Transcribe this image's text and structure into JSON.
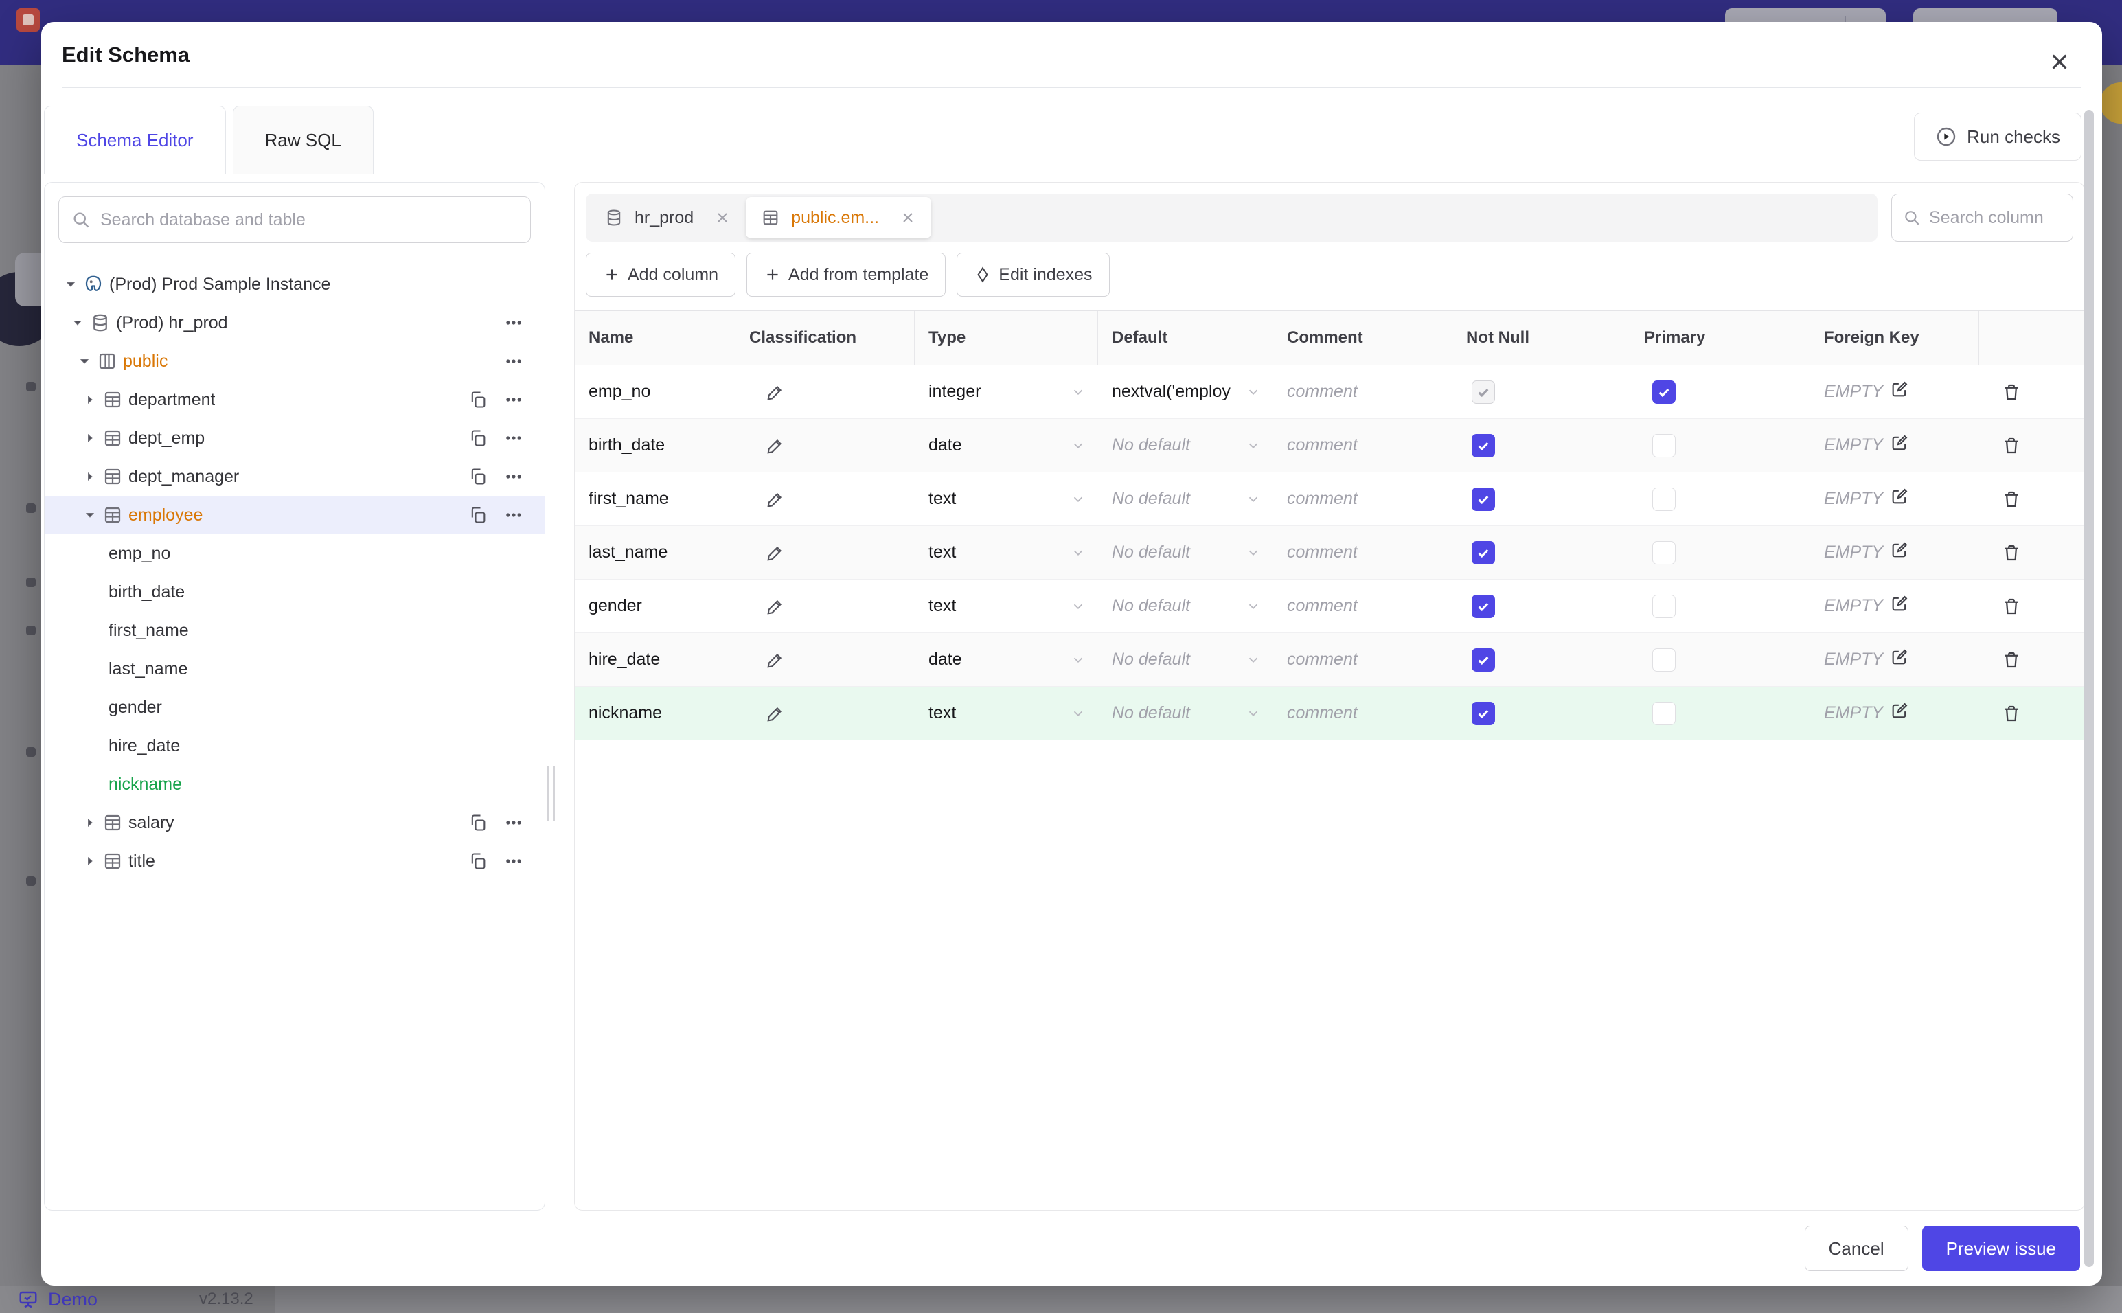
{
  "backdrop": {
    "demo_label": "Demo",
    "version": "v2.13.2"
  },
  "modal": {
    "title": "Edit Schema",
    "close_icon": "x-icon",
    "tabs": [
      {
        "label": "Schema Editor",
        "active": true
      },
      {
        "label": "Raw SQL",
        "active": false
      }
    ],
    "run_checks_label": "Run checks",
    "colors": {
      "accent": "#4f46e5",
      "modified_item": "#d97706",
      "new_item": "#16a34a",
      "selected_row_bg": "#eceefc",
      "new_row_bg": "#e9f9ef",
      "topbar": "#312d80"
    },
    "sidebar": {
      "search_placeholder": "Search database and table",
      "tree": [
        {
          "label": "(Prod) Prod Sample Instance",
          "level": 0,
          "icon": "postgres-icon",
          "expanded": true
        },
        {
          "label": "(Prod) hr_prod",
          "level": 1,
          "icon": "database-icon",
          "expanded": true,
          "actions": [
            "more"
          ]
        },
        {
          "label": "public",
          "level": 2,
          "icon": "schema-icon",
          "expanded": true,
          "modified": true,
          "actions": [
            "more"
          ]
        },
        {
          "label": "department",
          "level": 3,
          "icon": "table-icon",
          "expanded": false,
          "actions": [
            "copy",
            "more"
          ]
        },
        {
          "label": "dept_emp",
          "level": 3,
          "icon": "table-icon",
          "expanded": false,
          "actions": [
            "copy",
            "more"
          ]
        },
        {
          "label": "dept_manager",
          "level": 3,
          "icon": "table-icon",
          "expanded": false,
          "actions": [
            "copy",
            "more"
          ]
        },
        {
          "label": "employee",
          "level": 3,
          "icon": "table-icon",
          "expanded": true,
          "modified": true,
          "selected": true,
          "actions": [
            "copy",
            "more"
          ]
        },
        {
          "label": "emp_no",
          "level": 4
        },
        {
          "label": "birth_date",
          "level": 4
        },
        {
          "label": "first_name",
          "level": 4
        },
        {
          "label": "last_name",
          "level": 4
        },
        {
          "label": "gender",
          "level": 4
        },
        {
          "label": "hire_date",
          "level": 4
        },
        {
          "label": "nickname",
          "level": 4,
          "new": true
        },
        {
          "label": "salary",
          "level": 3,
          "icon": "table-icon",
          "expanded": false,
          "actions": [
            "copy",
            "more"
          ]
        },
        {
          "label": "title",
          "level": 3,
          "icon": "table-icon",
          "expanded": false,
          "actions": [
            "copy",
            "more"
          ]
        }
      ]
    },
    "main": {
      "open_tabs": [
        {
          "label": "hr_prod",
          "icon": "database-icon",
          "active": false
        },
        {
          "label": "public.em...",
          "icon": "table-icon",
          "active": true,
          "modified": true
        }
      ],
      "column_search_placeholder": "Search column",
      "toolbar": {
        "add_column": "Add column",
        "add_from_template": "Add from template",
        "edit_indexes": "Edit indexes"
      },
      "table": {
        "headers": [
          "Name",
          "Classification",
          "Type",
          "Default",
          "Comment",
          "Not Null",
          "Primary",
          "Foreign Key"
        ],
        "comment_placeholder": "comment",
        "no_default_placeholder": "No default",
        "fk_empty_label": "EMPTY",
        "rows": [
          {
            "name": "emp_no",
            "type": "integer",
            "default": "nextval('employ",
            "comment": "",
            "not_null": true,
            "not_null_disabled": true,
            "primary": true,
            "foreign_key": "EMPTY"
          },
          {
            "name": "birth_date",
            "type": "date",
            "default": "",
            "comment": "",
            "not_null": true,
            "primary": false,
            "foreign_key": "EMPTY"
          },
          {
            "name": "first_name",
            "type": "text",
            "default": "",
            "comment": "",
            "not_null": true,
            "primary": false,
            "foreign_key": "EMPTY"
          },
          {
            "name": "last_name",
            "type": "text",
            "default": "",
            "comment": "",
            "not_null": true,
            "primary": false,
            "foreign_key": "EMPTY"
          },
          {
            "name": "gender",
            "type": "text",
            "default": "",
            "comment": "",
            "not_null": true,
            "primary": false,
            "foreign_key": "EMPTY"
          },
          {
            "name": "hire_date",
            "type": "date",
            "default": "",
            "comment": "",
            "not_null": true,
            "primary": false,
            "foreign_key": "EMPTY"
          },
          {
            "name": "nickname",
            "type": "text",
            "default": "",
            "comment": "",
            "not_null": true,
            "primary": false,
            "foreign_key": "EMPTY",
            "new": true
          }
        ]
      }
    },
    "footer": {
      "cancel_label": "Cancel",
      "submit_label": "Preview issue"
    }
  }
}
